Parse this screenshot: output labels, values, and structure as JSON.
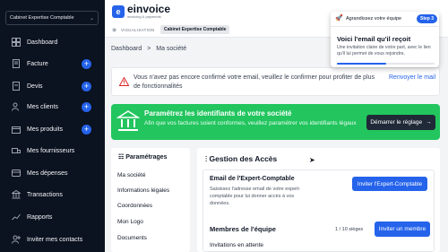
{
  "sidebar": {
    "company": "Cabinet Expertise Comptable",
    "items": [
      {
        "label": "Dashboard",
        "icon": "grid-icon",
        "plus": false
      },
      {
        "label": "Facture",
        "icon": "invoice-icon",
        "plus": true
      },
      {
        "label": "Devis",
        "icon": "quote-icon",
        "plus": true
      },
      {
        "label": "Mes clients",
        "icon": "users-icon",
        "plus": true
      },
      {
        "label": "Mes produits",
        "icon": "box-icon",
        "plus": true
      },
      {
        "label": "Mes fournisseurs",
        "icon": "truck-icon",
        "plus": false
      },
      {
        "label": "Mes dépenses",
        "icon": "receipt-icon",
        "plus": false
      },
      {
        "label": "Transactions",
        "icon": "bank-icon",
        "plus": false
      },
      {
        "label": "Rapports",
        "icon": "chart-icon",
        "plus": false
      },
      {
        "label": "Inviter mes contacts",
        "icon": "invite-icon",
        "plus": false
      }
    ]
  },
  "topbar": {
    "logo_name": "einvoice",
    "logo_tag": "invoicing & payments",
    "view_label": "VISUALISATION",
    "view_company": "Cabinet Expertise Comptable"
  },
  "breadcrumb": {
    "root": "Dashboard",
    "separator": ">",
    "current": "Ma société"
  },
  "warning": {
    "text": "Vous n'avez pas encore confirmé votre email, veuillez le confirmer pour profiter de plus de fonctionnalités",
    "link": "Renvoyer le mail"
  },
  "banner": {
    "title": "Paramétrez les identifiants de votre société",
    "subtitle": "Afin que vos factures soient conformes, veuillez paramétrer vos identifiants légaux",
    "button": "Démarrer le réglage",
    "color": "#22c55e"
  },
  "settings": {
    "title": "Paramétrages",
    "items": [
      "Ma société",
      "Informations légales",
      "Coordonnées",
      "Mon Logo",
      "Documents"
    ]
  },
  "access": {
    "title": "Gestion des Accès",
    "expert_title": "Email de l'Expert-Comptable",
    "expert_desc": "Saisissez l'adresse email de votre expert-comptable pour lui donner accès à vos données.",
    "expert_button": "Inviter l'Expert-Comptable",
    "members_title": "Membres de l'équipe",
    "seats": "1 / 10 sièges",
    "invite_button": "Inviter un membre",
    "pending_title": "Invitations en attente"
  },
  "tour": {
    "label": "Agrandissez votre équipe",
    "step": "Step 3",
    "title": "Voici l'email qu'il reçoit",
    "desc": "Une invitation claire de votre part, avec le lien qu'il lui permet de vous rejoindre.",
    "progress": 0.5
  },
  "colors": {
    "accent": "#2563eb",
    "sidebar": "#0b1220",
    "success": "#22c55e",
    "danger": "#dc2626"
  }
}
